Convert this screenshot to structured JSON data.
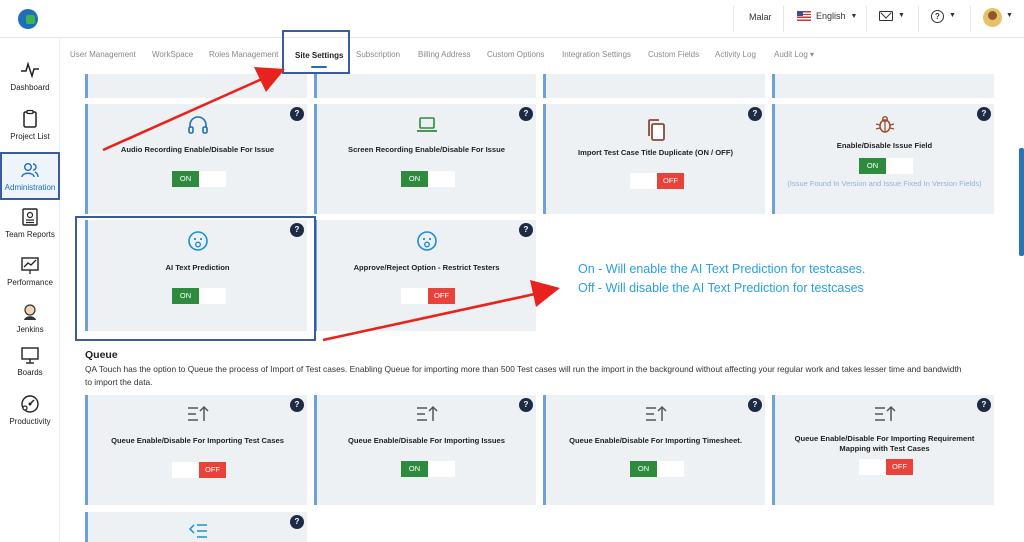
{
  "header": {
    "user": "Malar",
    "language": "English"
  },
  "sidebar": {
    "items": [
      {
        "label": "Dashboard"
      },
      {
        "label": "Project List"
      },
      {
        "label": "Administration"
      },
      {
        "label": "Team Reports"
      },
      {
        "label": "Performance"
      },
      {
        "label": "Jenkins"
      },
      {
        "label": "Boards"
      },
      {
        "label": "Productivity"
      }
    ]
  },
  "tabs": [
    "User Management",
    "WorkSpace",
    "Roles Management",
    "Site Settings",
    "Subscription",
    "Billing Address",
    "Custom Options",
    "Integration Settings",
    "Custom Fields",
    "Activity Log",
    "Audit Log"
  ],
  "help_symbol": "?",
  "on_label": "ON",
  "off_label": "OFF",
  "cards": [
    {
      "title": "Audio Recording Enable/Disable For Issue",
      "state": "on",
      "icon": "headphones-icon"
    },
    {
      "title": "Screen Recording Enable/Disable For Issue",
      "state": "on",
      "icon": "laptop-icon"
    },
    {
      "title": "Import Test Case Title Duplicate (ON / OFF)",
      "state": "off",
      "icon": "copy-icon"
    },
    {
      "title": "Enable/Disable Issue Field",
      "state": "on",
      "icon": "bug-icon",
      "subtitle": "(Issue Found In Version and Issue Fixed In Version Fields)"
    },
    {
      "title": "AI Text Prediction",
      "state": "on",
      "icon": "surprised-face-icon"
    },
    {
      "title": "Approve/Reject Option - Restrict Testers",
      "state": "off",
      "icon": "surprised-face-icon"
    }
  ],
  "note": {
    "line1": "On - Will enable the AI Text Prediction for testcases.",
    "line2": "Off - Will disable the AI Text Prediction for testcases"
  },
  "queue": {
    "title": "Queue",
    "description": "QA Touch has the option to Queue the process of Import of Test cases. Enabling Queue for importing more than 500 Test cases will run the import in the background without affecting your regular work and takes lesser time and bandwidth to import the data.",
    "cards": [
      {
        "title": "Queue Enable/Disable For Importing Test Cases",
        "state": "off",
        "icon": "sort-up-icon"
      },
      {
        "title": "Queue Enable/Disable For Importing Issues",
        "state": "on",
        "icon": "sort-up-icon"
      },
      {
        "title": "Queue Enable/Disable For Importing Timesheet.",
        "state": "on",
        "icon": "sort-up-icon"
      },
      {
        "title": "Queue Enable/Disable For Importing Requirement Mapping with Test Cases",
        "state": "off",
        "icon": "sort-up-icon"
      }
    ]
  },
  "colors": {
    "accent": "#1c6fb8",
    "on": "#2e8b3e",
    "off": "#e8423a",
    "annotation_arrow": "#e8221c",
    "note_text": "#2aa0e0",
    "card_bg": "#eef1f4"
  }
}
